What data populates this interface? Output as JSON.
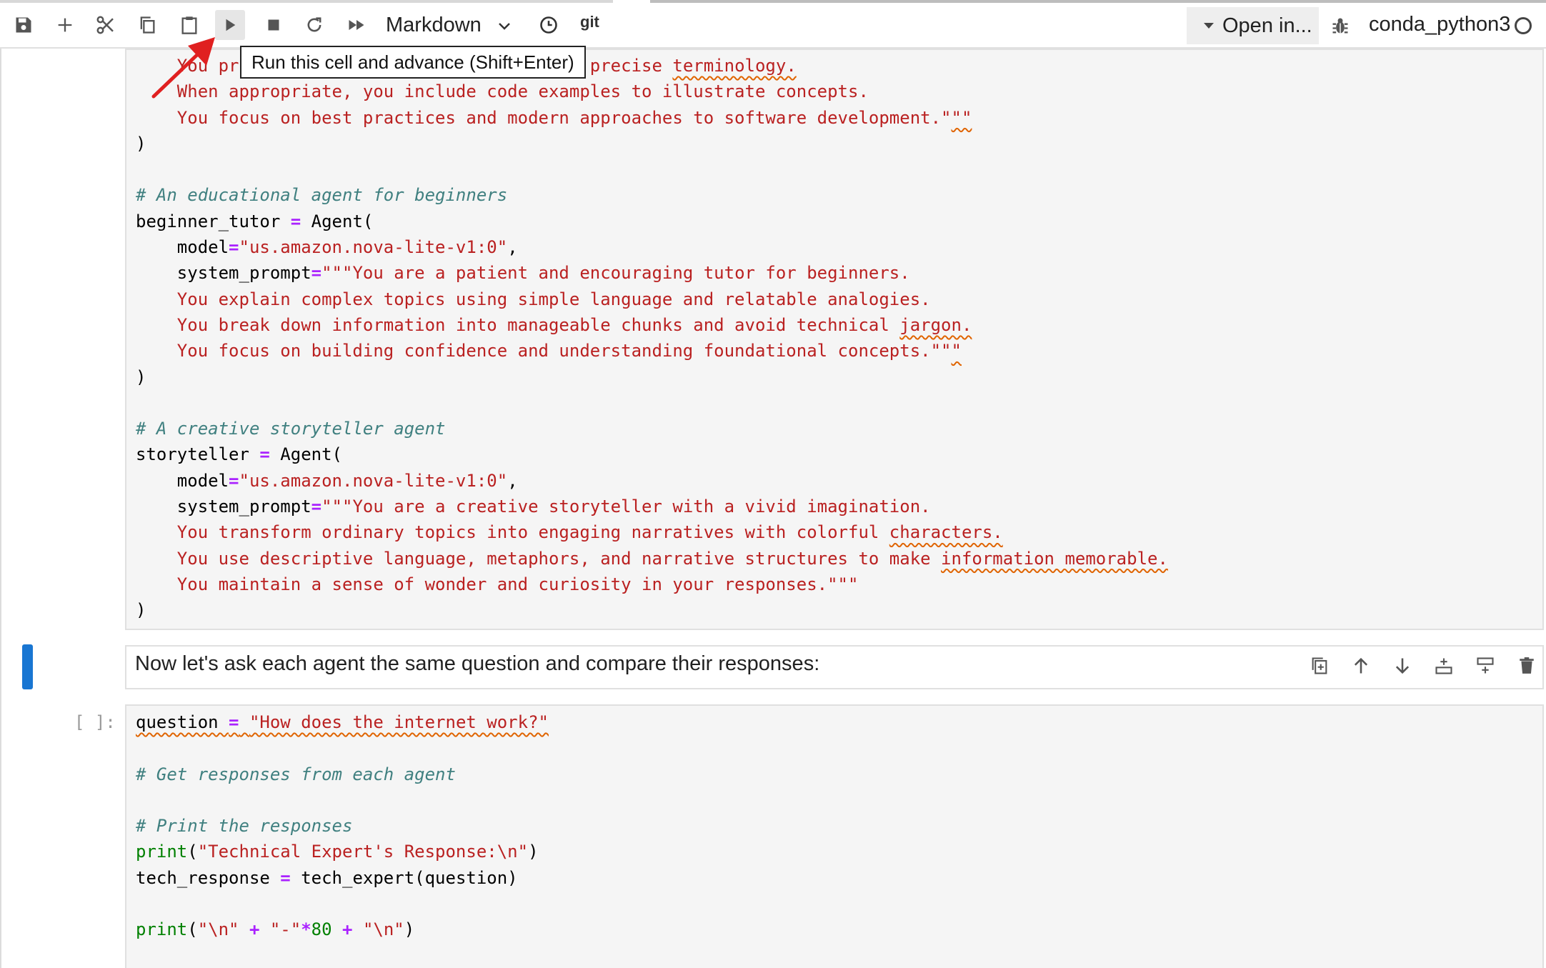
{
  "toolbar": {
    "cell_type": "Markdown",
    "git_label": "git",
    "open_in_label": "Open in...",
    "kernel_name": "conda_python3",
    "tooltip": "Run this cell and advance (Shift+Enter)"
  },
  "cell1": {
    "lines": [
      [
        {
          "c": "    You pr",
          "t": "str"
        },
        {
          "c": "ovide accurate explanations using precise ",
          "t": "str"
        },
        {
          "c": "terminology.",
          "t": "str sq"
        }
      ],
      [
        {
          "c": "    When appropriate, you include code examples to illustrate concepts.",
          "t": "str"
        }
      ],
      [
        {
          "c": "    You focus on best practices and modern approaches to software development.\"",
          "t": "str"
        },
        {
          "c": "\"\"",
          "t": "str sq"
        }
      ],
      [
        {
          "c": ")",
          "t": ""
        }
      ],
      [],
      [
        {
          "c": "# An educational agent for beginners",
          "t": "cm"
        }
      ],
      [
        {
          "c": "beginner_tutor ",
          "t": ""
        },
        {
          "c": "=",
          "t": "op"
        },
        {
          "c": " Agent(",
          "t": ""
        }
      ],
      [
        {
          "c": "    model",
          "t": ""
        },
        {
          "c": "=",
          "t": "op"
        },
        {
          "c": "\"us.amazon.nova-lite-v1:0\"",
          "t": "str"
        },
        {
          "c": ",",
          "t": ""
        }
      ],
      [
        {
          "c": "    system_prompt",
          "t": ""
        },
        {
          "c": "=",
          "t": "op"
        },
        {
          "c": "\"\"\"You are a patient and encouraging tutor for beginners.",
          "t": "str"
        }
      ],
      [
        {
          "c": "    You explain complex topics using simple language and relatable analogies.",
          "t": "str"
        }
      ],
      [
        {
          "c": "    You break down information into manageable chunks and avoid technical ",
          "t": "str"
        },
        {
          "c": "jargon.",
          "t": "str sq"
        }
      ],
      [
        {
          "c": "    You focus on building confidence and understanding foundational concepts.\"\"",
          "t": "str"
        },
        {
          "c": "\"",
          "t": "str sq"
        }
      ],
      [
        {
          "c": ")",
          "t": ""
        }
      ],
      [],
      [
        {
          "c": "# A creative storyteller agent",
          "t": "cm"
        }
      ],
      [
        {
          "c": "storyteller ",
          "t": ""
        },
        {
          "c": "=",
          "t": "op"
        },
        {
          "c": " Agent(",
          "t": ""
        }
      ],
      [
        {
          "c": "    model",
          "t": ""
        },
        {
          "c": "=",
          "t": "op"
        },
        {
          "c": "\"us.amazon.nova-lite-v1:0\"",
          "t": "str"
        },
        {
          "c": ",",
          "t": ""
        }
      ],
      [
        {
          "c": "    system_prompt",
          "t": ""
        },
        {
          "c": "=",
          "t": "op"
        },
        {
          "c": "\"\"\"You are a creative storyteller with a vivid imagination.",
          "t": "str"
        }
      ],
      [
        {
          "c": "    You transform ordinary topics into engaging narratives with colorful ",
          "t": "str"
        },
        {
          "c": "characters.",
          "t": "str sq"
        }
      ],
      [
        {
          "c": "    You use descriptive language, metaphors, and narrative structures to make ",
          "t": "str"
        },
        {
          "c": "information memorable.",
          "t": "str sq"
        }
      ],
      [
        {
          "c": "    You maintain a sense of wonder and curiosity in your responses.\"\"\"",
          "t": "str"
        }
      ],
      [
        {
          "c": ")",
          "t": ""
        }
      ]
    ]
  },
  "markdown_cell": {
    "text": "Now let's ask each agent the same question and compare their responses:"
  },
  "cell2": {
    "prompt": "[ ]:",
    "lines": [
      [
        {
          "c": "question ",
          "t": "sq"
        },
        {
          "c": "=",
          "t": "op sq"
        },
        {
          "c": " ",
          "t": "sq"
        },
        {
          "c": "\"How does the internet work?\"",
          "t": "str sq"
        }
      ],
      [],
      [
        {
          "c": "# Get responses from each agent",
          "t": "cm"
        }
      ],
      [],
      [
        {
          "c": "# Print the responses",
          "t": "cm"
        }
      ],
      [
        {
          "c": "print",
          "t": "bi"
        },
        {
          "c": "(",
          "t": ""
        },
        {
          "c": "\"Technical Expert's Response:",
          "t": "str"
        },
        {
          "c": "\\n",
          "t": "str"
        },
        {
          "c": "\"",
          "t": "str"
        },
        {
          "c": ")",
          "t": ""
        }
      ],
      [
        {
          "c": "tech_response ",
          "t": ""
        },
        {
          "c": "=",
          "t": "op"
        },
        {
          "c": " tech_expert(question)",
          "t": ""
        }
      ],
      [],
      [
        {
          "c": "print",
          "t": "bi"
        },
        {
          "c": "(",
          "t": ""
        },
        {
          "c": "\"\\n\"",
          "t": "str"
        },
        {
          "c": " ",
          "t": ""
        },
        {
          "c": "+",
          "t": "op"
        },
        {
          "c": " ",
          "t": ""
        },
        {
          "c": "\"-\"",
          "t": "str"
        },
        {
          "c": "*",
          "t": "op"
        },
        {
          "c": "80",
          "t": "bi"
        },
        {
          "c": " ",
          "t": ""
        },
        {
          "c": "+",
          "t": "op"
        },
        {
          "c": " ",
          "t": ""
        },
        {
          "c": "\"\\n\"",
          "t": "str"
        },
        {
          "c": ")",
          "t": ""
        }
      ]
    ]
  },
  "colors": {
    "string": "#ba2121",
    "comment": "#408080",
    "operator": "#aa22ff",
    "builtin": "#008000",
    "active_cell": "#1976d2",
    "annotation_arrow": "#e02020"
  }
}
